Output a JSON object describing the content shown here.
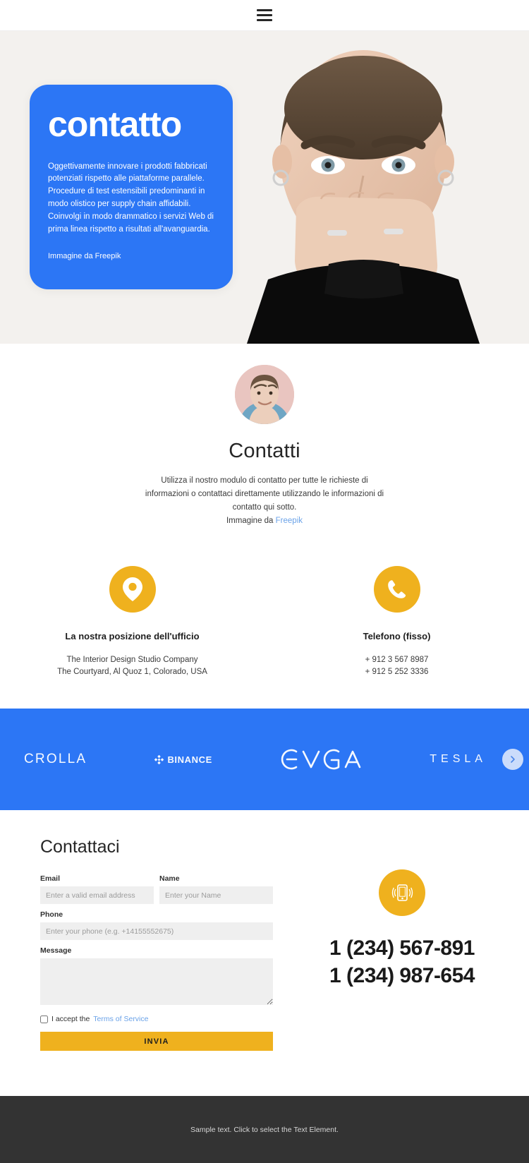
{
  "colors": {
    "blue": "#2c76f5",
    "yellow": "#efb11e",
    "hero_bg": "#f3f1ee",
    "footer_bg": "#333333",
    "link_blue": "#6aa2e8",
    "input_bg": "#efefef"
  },
  "topbar": {
    "menu_icon": "hamburger-menu-icon"
  },
  "hero": {
    "title": "contatto",
    "body": "Oggettivamente innovare i prodotti fabbricati potenziati rispetto alle piattaforme parallele. Procedure di test estensibili predominanti in modo olistico per supply chain affidabili. Coinvolgi in modo drammatico i servizi Web di prima linea rispetto a risultati all'avanguardia.",
    "credit": "Immagine da Freepik"
  },
  "intro": {
    "avatar_icon": "avatar-portrait",
    "title": "Contatti",
    "description": "Utilizza il nostro modulo di contatto per tutte le richieste di informazioni o contattaci direttamente utilizzando le informazioni di contatto qui sotto.",
    "credit_prefix": "Immagine da ",
    "credit_link": "Freepik"
  },
  "cards": [
    {
      "icon": "location-pin-icon",
      "title": "La nostra posizione dell'ufficio",
      "lines": [
        "The Interior Design Studio Company",
        "The Courtyard, Al Quoz 1, Colorado,  USA"
      ]
    },
    {
      "icon": "phone-handset-icon",
      "title": "Telefono (fisso)",
      "lines": [
        "+ 912 3 567 8987",
        "+ 912 5 252 3336"
      ]
    }
  ],
  "band": {
    "logos": [
      {
        "name": "crolla-logo",
        "label": "CROLLA"
      },
      {
        "name": "binance-logo",
        "label": "BINANCE"
      },
      {
        "name": "evga-logo",
        "label": "EVGA"
      },
      {
        "name": "tesla-logo",
        "label": "TESLA"
      }
    ],
    "next_icon": "chevron-right-icon"
  },
  "form": {
    "title": "Contattaci",
    "email": {
      "label": "Email",
      "placeholder": "Enter a valid email address",
      "value": ""
    },
    "name": {
      "label": "Name",
      "placeholder": "Enter your Name",
      "value": ""
    },
    "phone": {
      "label": "Phone",
      "placeholder": "Enter your phone (e.g. +14155552675)",
      "value": ""
    },
    "message": {
      "label": "Message",
      "placeholder": "",
      "value": ""
    },
    "terms_prefix": "I accept the ",
    "terms_link": "Terms of Service",
    "terms_checked": false,
    "submit_label": "INVIA"
  },
  "phone_panel": {
    "icon": "mobile-phone-ringing-icon",
    "numbers": [
      "1 (234) 567-891",
      "1 (234) 987-654"
    ]
  },
  "footer": {
    "text": "Sample text. Click to select the Text Element."
  }
}
